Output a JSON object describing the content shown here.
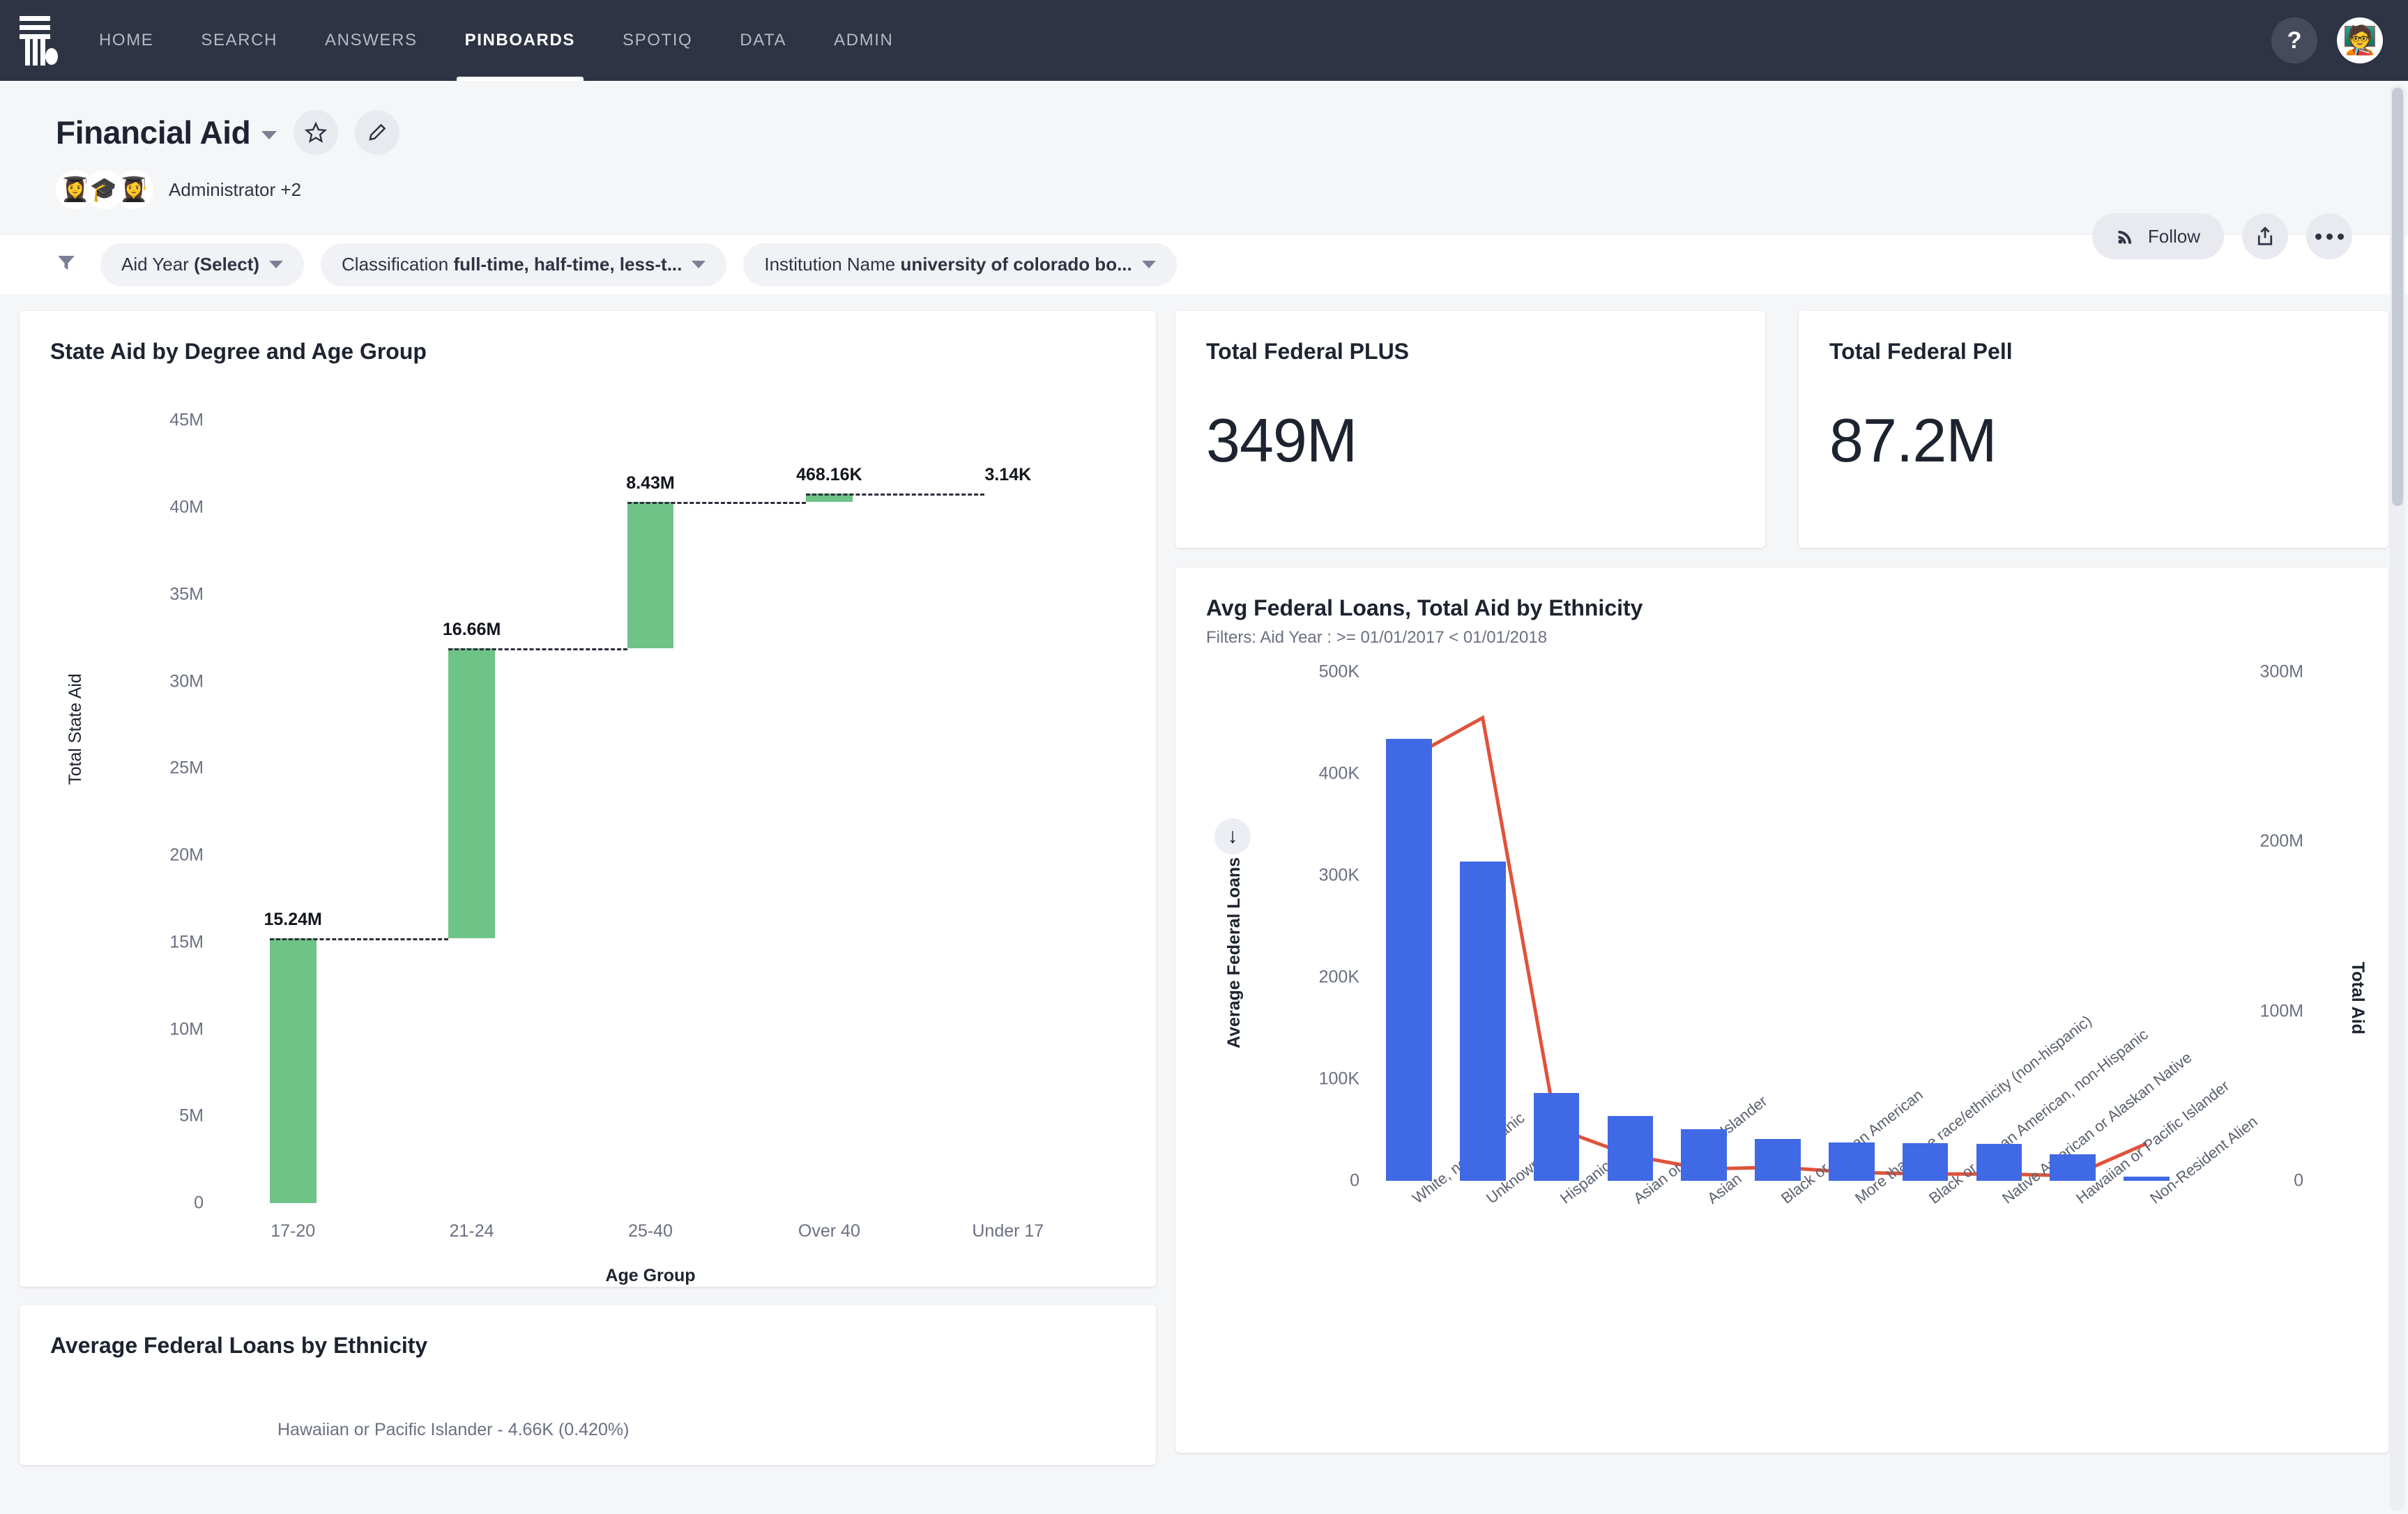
{
  "nav": {
    "logo_icon": "thoughtspot-logo-icon",
    "links": [
      {
        "label": "HOME",
        "active": false
      },
      {
        "label": "SEARCH",
        "active": false
      },
      {
        "label": "ANSWERS",
        "active": false
      },
      {
        "label": "PINBOARDS",
        "active": true
      },
      {
        "label": "SPOTIQ",
        "active": false
      },
      {
        "label": "DATA",
        "active": false
      },
      {
        "label": "ADMIN",
        "active": false
      }
    ],
    "help_label": "?",
    "avatar_glyph": "🧑‍🏫"
  },
  "header": {
    "title": "Financial Aid",
    "star_icon": "star-icon",
    "edit_icon": "pencil-icon",
    "owner": "Administrator +2",
    "avatar_glyphs": [
      "👩‍🎓",
      "🎓",
      "👩‍🎓"
    ],
    "follow_label": "Follow",
    "follow_icon": "rss-icon",
    "share_icon": "share-icon",
    "more_icon": "more-horizontal-icon"
  },
  "filters": {
    "funnel_icon": "filter-icon",
    "chips": [
      {
        "name": "Aid Year",
        "value": "(Select)"
      },
      {
        "name": "Classification",
        "value": "full-time, half-time, less-t..."
      },
      {
        "name": "Institution Name",
        "value": "university of colorado bo..."
      }
    ]
  },
  "kpis": [
    {
      "title": "Total Federal PLUS",
      "value": "349M"
    },
    {
      "title": "Total Federal Pell",
      "value": "87.2M"
    }
  ],
  "pie_card": {
    "title": "Average Federal Loans by Ethnicity",
    "snippet": "Hawaiian or Pacific Islander - 4.66K (0.420%)"
  },
  "chart_data": [
    {
      "type": "bar",
      "chart_style": "waterfall",
      "title": "State Aid by Degree and Age Group",
      "xlabel": "Age Group",
      "ylabel": "Total State Aid",
      "categories": [
        "17-20",
        "21-24",
        "25-40",
        "Over 40",
        "Under 17"
      ],
      "values": [
        15240000,
        16660000,
        8430000,
        468160,
        3140
      ],
      "data_labels": [
        "15.24M",
        "16.66M",
        "8.43M",
        "468.16K",
        "3.14K"
      ],
      "cumulative_start": [
        0,
        15240000,
        31900000,
        40330000,
        40798160
      ],
      "cumulative_end": [
        15240000,
        31900000,
        40330000,
        40798160,
        40801300
      ],
      "ylim": [
        0,
        46500000
      ],
      "yticks": [
        0,
        5000000,
        10000000,
        15000000,
        20000000,
        25000000,
        30000000,
        35000000,
        40000000,
        45000000
      ],
      "ytick_labels": [
        "0",
        "5M",
        "10M",
        "15M",
        "20M",
        "25M",
        "30M",
        "35M",
        "40M",
        "45M"
      ],
      "bar_color": "#6ec387",
      "connector_color": "#2c2f3a",
      "grid": false,
      "legend": "none"
    },
    {
      "type": "bar",
      "chart_style": "combo-bar-line",
      "title": "Avg Federal Loans, Total Aid by Ethnicity",
      "subtitle": "Filters: Aid Year : >= 01/01/2017 < 01/01/2018",
      "categories": [
        "White, non-Hispanic",
        "Unknown",
        "Hispanic",
        "Asian or Pacific Islander",
        "Asian",
        "Black or African American",
        "More than one race/ethnicity (non-hispanic)",
        "Black or African American, non-Hispanic",
        "Native American or Alaskan Native",
        "Hawaiian or Pacific Islander",
        "Non-Resident Alien"
      ],
      "series": [
        {
          "name": "Average Federal Loans",
          "type": "bar",
          "axis": "left",
          "color": "#4069e5",
          "values": [
            434000,
            314000,
            86000,
            64000,
            51000,
            41000,
            38000,
            37000,
            36000,
            26000,
            4000
          ]
        },
        {
          "name": "Total Aid",
          "type": "line",
          "axis": "right",
          "color": "#e0523b",
          "values": [
            249000000,
            273000000,
            31000000,
            15000000,
            7000000,
            8000000,
            5000000,
            4000000,
            4000000,
            3000000,
            22000000
          ]
        }
      ],
      "left_axis": {
        "label": "Average Federal Loans",
        "ylim": [
          0,
          500000
        ],
        "ticks": [
          0,
          100000,
          200000,
          300000,
          400000,
          500000
        ],
        "tick_labels": [
          "0",
          "100K",
          "200K",
          "300K",
          "400K",
          "500K"
        ]
      },
      "right_axis": {
        "label": "Total Aid",
        "ylim": [
          0,
          300000000
        ],
        "ticks": [
          0,
          100000000,
          200000000,
          300000000
        ],
        "tick_labels": [
          "0",
          "100M",
          "200M",
          "300M"
        ]
      },
      "drill_icon": "drill-down-arrow-icon",
      "grid": false,
      "legend": "none"
    }
  ]
}
